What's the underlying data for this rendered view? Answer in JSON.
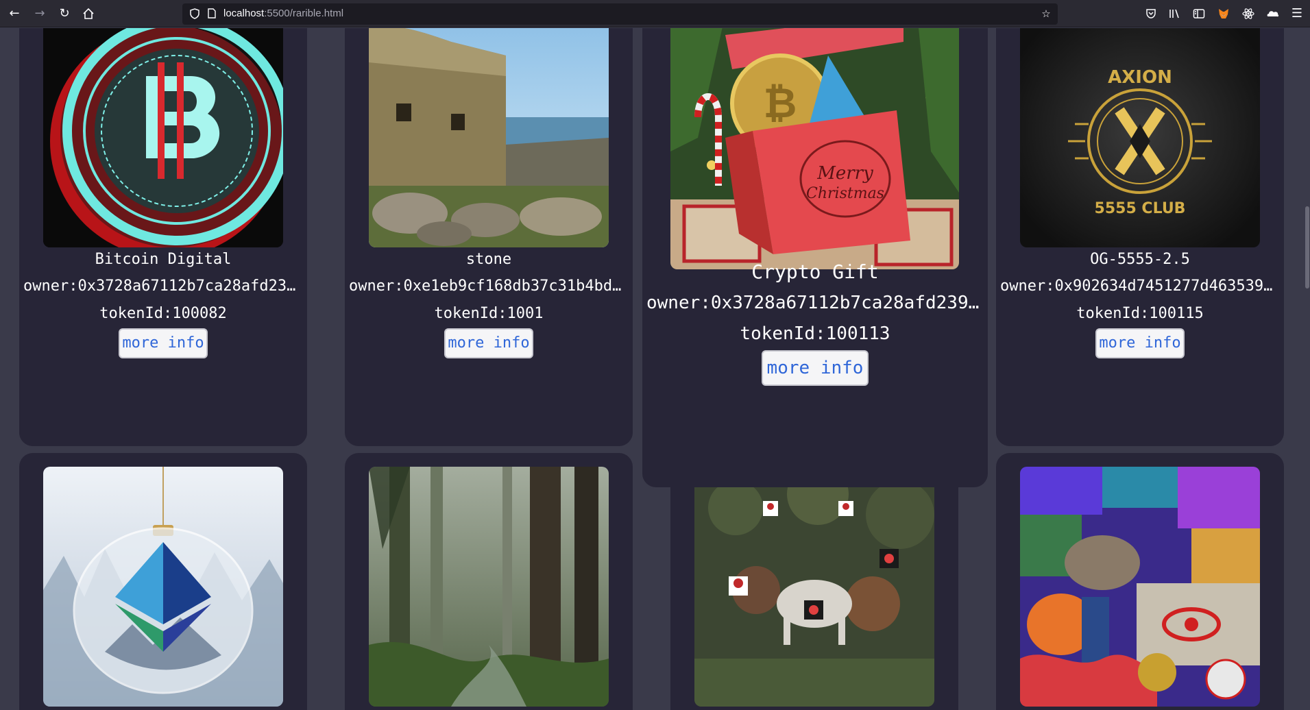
{
  "browser": {
    "url_host": "localhost",
    "url_path": ":5500/rarible.html"
  },
  "cards": [
    {
      "title": "Bitcoin Digital",
      "owner": "owner:0x3728a67112b7ca28afd2394a...",
      "token": "tokenId:100082",
      "button": "more info"
    },
    {
      "title": "stone",
      "owner": "owner:0xe1eb9cf168db37c31b4bdf735...",
      "token": "tokenId:1001",
      "button": "more info"
    },
    {
      "title": "Crypto Gift",
      "owner": "owner:0x3728a67112b7ca28afd2394a...",
      "token": "tokenId:100113",
      "button": "more info"
    },
    {
      "title": "OG-5555-2.5",
      "owner": "owner:0x902634d7451277d46353969d...",
      "token": "tokenId:100115",
      "button": "more info"
    }
  ],
  "images": {
    "axion_logo_top": "AXION",
    "axion_logo_bottom": "5555 CLUB"
  },
  "colors": {
    "page_bg": "#3a3a4a",
    "card_bg": "#272537",
    "button_text": "#2f66d8"
  }
}
